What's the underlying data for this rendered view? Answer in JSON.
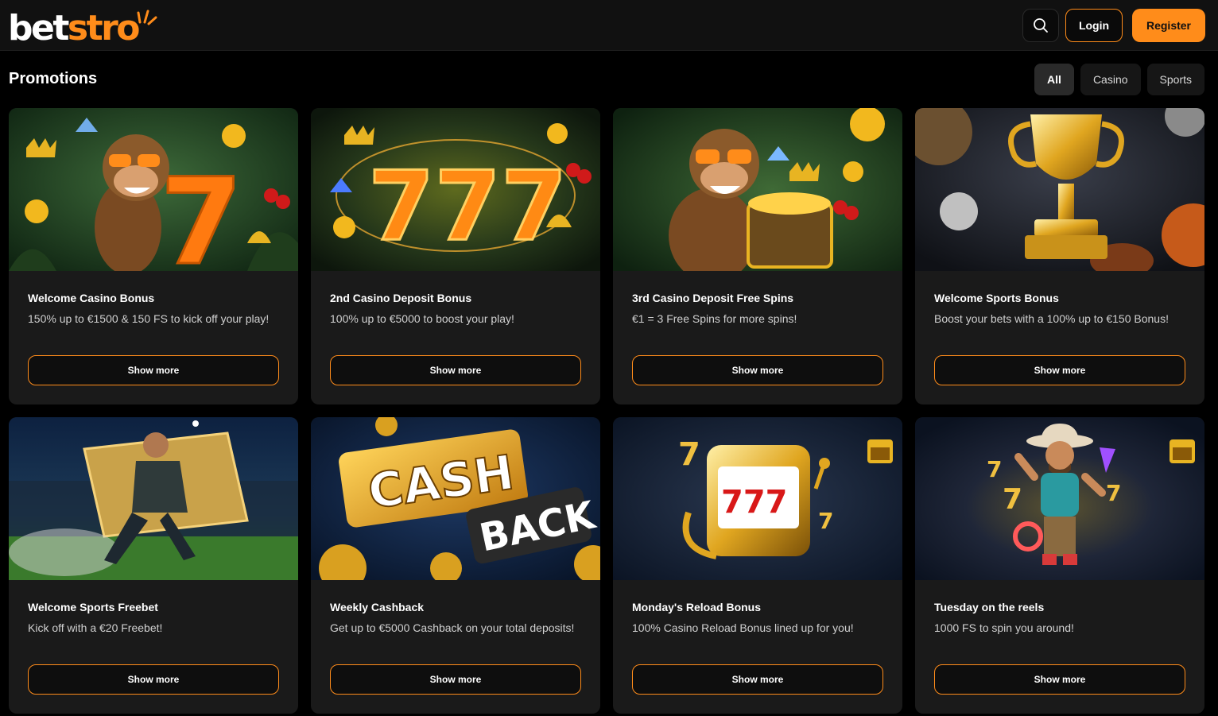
{
  "brand": {
    "part1": "bet",
    "part2": "stro",
    "accent": "#ff8c1a"
  },
  "header": {
    "login_label": "Login",
    "register_label": "Register",
    "search_icon": "search-icon"
  },
  "page": {
    "title": "Promotions"
  },
  "filters": [
    {
      "label": "All",
      "active": true
    },
    {
      "label": "Casino",
      "active": false
    },
    {
      "label": "Sports",
      "active": false
    }
  ],
  "promotions": [
    {
      "title": "Welcome Casino Bonus",
      "description": "150% up to €1500 & 150 FS to kick off your play!",
      "button": "Show more",
      "image": "monkey-seven-jungle"
    },
    {
      "title": "2nd Casino Deposit Bonus",
      "description": "100% up to €5000 to boost your play!",
      "button": "Show more",
      "image": "golden-777"
    },
    {
      "title": "3rd Casino Deposit Free Spins",
      "description": "€1 = 3 Free Spins for more spins!",
      "button": "Show more",
      "image": "monkey-treasure-chest"
    },
    {
      "title": "Welcome Sports Bonus",
      "description": "Boost your bets with a 100% up to €150 Bonus!",
      "button": "Show more",
      "image": "golden-trophy"
    },
    {
      "title": "Welcome Sports Freebet",
      "description": "Kick off with a €20 Freebet!",
      "button": "Show more",
      "image": "football-player-ticket"
    },
    {
      "title": "Weekly Cashback",
      "description": "Get up to €5000 Cashback on your total deposits!",
      "button": "Show more",
      "image": "cash-back-sign",
      "image_text_1": "CASH",
      "image_text_2": "BACK"
    },
    {
      "title": "Monday's Reload Bonus",
      "description": "100% Casino Reload Bonus lined up for you!",
      "button": "Show more",
      "image": "slot-machine-777"
    },
    {
      "title": "Tuesday on the reels",
      "description": "1000 FS to spin you around!",
      "button": "Show more",
      "image": "cowboy-character"
    }
  ]
}
